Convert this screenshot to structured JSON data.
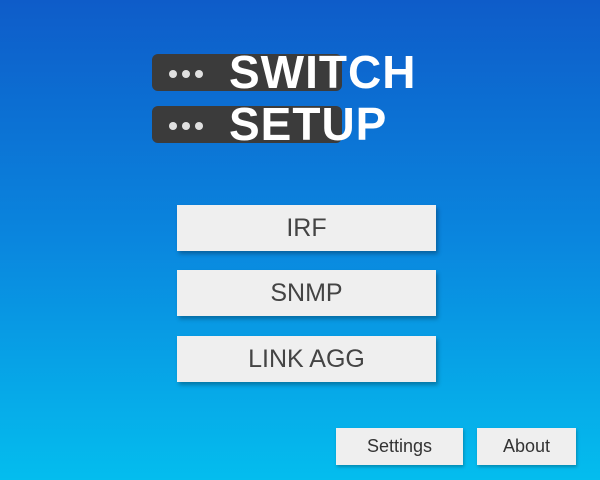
{
  "logo": {
    "line1": "SWITCH",
    "line2": "SETUP",
    "icon": "server-rack-icon"
  },
  "menu": {
    "irf_label": "IRF",
    "snmp_label": "SNMP",
    "link_agg_label": "LINK AGG"
  },
  "footer": {
    "settings_label": "Settings",
    "about_label": "About"
  },
  "colors": {
    "background_top": "#0e5cc9",
    "background_bottom": "#04bdee",
    "button_face": "#efefef",
    "button_text": "#444444",
    "rack_bar": "#3b3b3b"
  }
}
